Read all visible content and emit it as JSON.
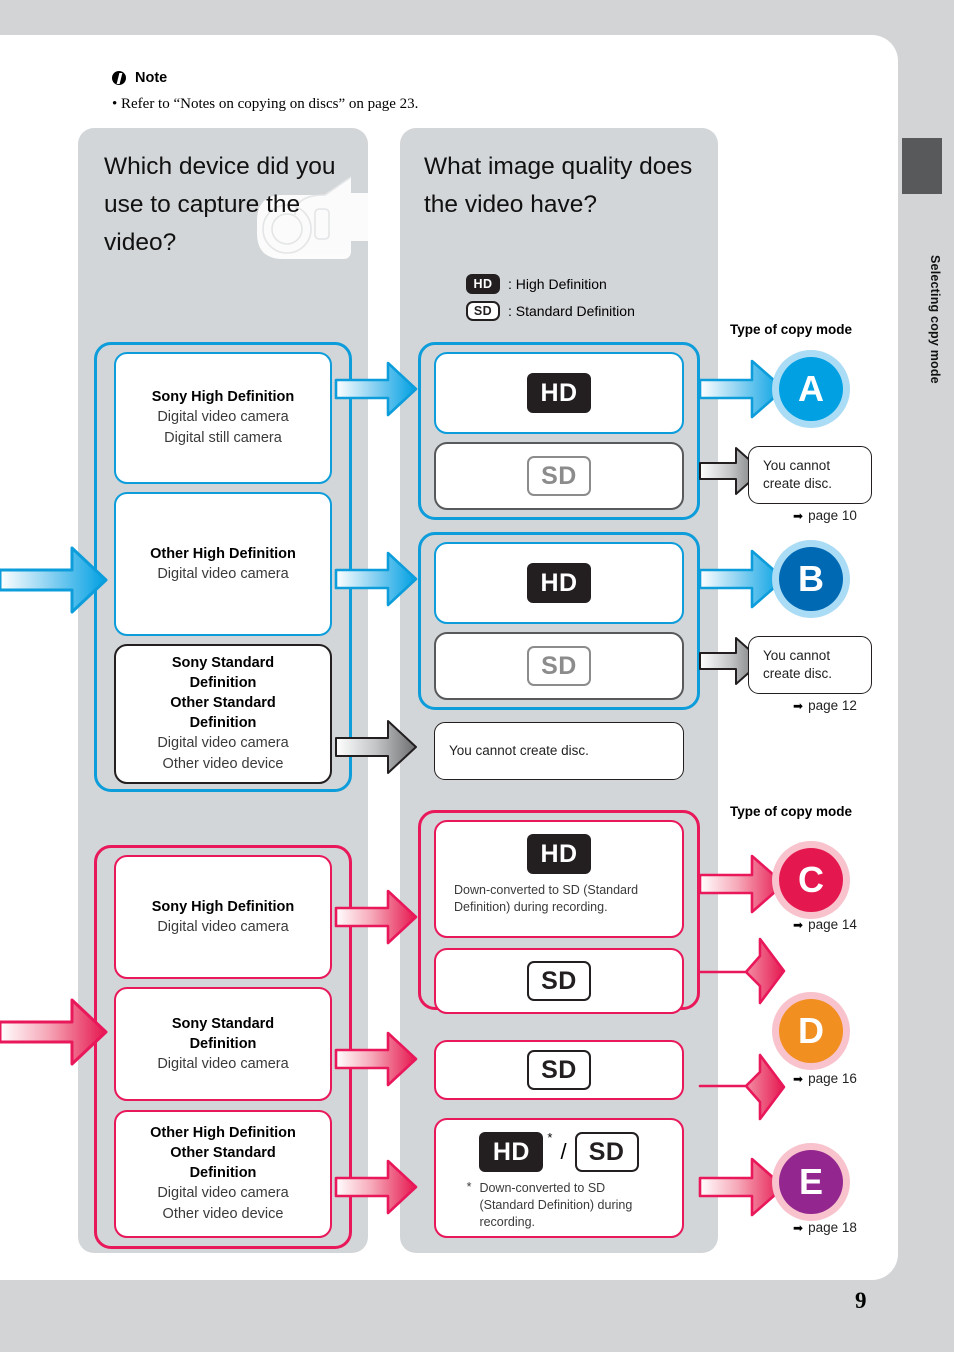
{
  "note": {
    "icon": "note-icon",
    "heading": "Note",
    "text": "• Refer to “Notes on copying on discs” on page 23."
  },
  "side_tab": {
    "label": "Selecting copy mode"
  },
  "page_number": "9",
  "columns": {
    "left_question": "Which device did you use to capture the video?",
    "mid_question": "What image quality does the video have?"
  },
  "legend": [
    {
      "chip": "HD",
      "text": ": High Definition"
    },
    {
      "chip": "SD",
      "text": ": Standard Definition"
    }
  ],
  "copy_mode_label_top": "Type of copy mode",
  "copy_mode_label_bottom": "Type of copy mode",
  "devices": {
    "sony_hd_1": {
      "title": "Sony High Definition",
      "line1": "Digital video camera",
      "line2": "Digital still camera"
    },
    "other_hd_1": {
      "title": "Other High Definition",
      "line1": "Digital video camera"
    },
    "std_1": {
      "title1": "Sony Standard",
      "title2": "Definition",
      "title3": "Other Standard",
      "title4": "Definition",
      "line1": "Digital video camera",
      "line2": "Other video device"
    },
    "sony_hd_2": {
      "title": "Sony High Definition",
      "line1": "Digital video camera"
    },
    "sony_sd_2": {
      "title1": "Sony Standard",
      "title2": "Definition",
      "line1": "Digital video camera"
    },
    "other_2": {
      "title1": "Other High Definition",
      "title2": "Other Standard",
      "title3": "Definition",
      "line1": "Digital video camera",
      "line2": "Other video device"
    }
  },
  "quality": {
    "hd_label": "HD",
    "sd_label": "SD",
    "downconvert_1": "Down-converted to SD (Standard Definition) during recording.",
    "slash": "/",
    "asterisk": "*",
    "downconvert_2": "Down-converted to SD (Standard Definition) during recording."
  },
  "messages": {
    "cannot_a": "You cannot create disc.",
    "cannot_b": "You cannot create disc.",
    "cannot_std": "You cannot create disc."
  },
  "modes": [
    {
      "letter": "A",
      "page": "page 10",
      "color": "#00a0e3"
    },
    {
      "letter": "B",
      "page": "page 12",
      "color": "#0069b4"
    },
    {
      "letter": "C",
      "page": "page 14",
      "color": "#e5174f"
    },
    {
      "letter": "D",
      "page": "page 16",
      "color": "#f18f20"
    },
    {
      "letter": "E",
      "page": "page 18",
      "color": "#93278f"
    }
  ],
  "colors": {
    "page_bg": "#d2d4d5",
    "panel": "#d3d6d8",
    "blue": "#0d9ddb",
    "pink": "#e8185b",
    "dark": "#231f20"
  }
}
